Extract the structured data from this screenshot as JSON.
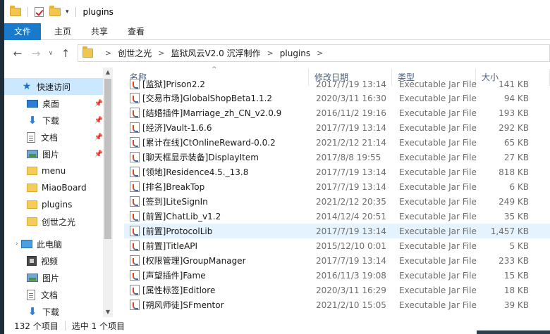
{
  "titlebar": {
    "title": "plugins",
    "dropdown_glyph": "▾"
  },
  "ribbon": {
    "tabs": [
      "文件",
      "主页",
      "共享",
      "查看"
    ]
  },
  "address": {
    "back": "←",
    "forward": "→",
    "recent": "∨",
    "up": "↑",
    "crumbs": [
      "创世之光",
      "监狱风云V2.0 沉浮制作",
      "plugins"
    ],
    "sep": ">"
  },
  "nav": {
    "quick_access": "快速访问",
    "items": [
      {
        "label": "桌面",
        "icon": "desktop-icon",
        "pinned": true
      },
      {
        "label": "下载",
        "icon": "download-icon",
        "pinned": true
      },
      {
        "label": "文档",
        "icon": "document-icon",
        "pinned": true
      },
      {
        "label": "图片",
        "icon": "pictures-icon",
        "pinned": true
      },
      {
        "label": "menu",
        "icon": "folder-icon"
      },
      {
        "label": "MiaoBoard",
        "icon": "folder-icon"
      },
      {
        "label": "plugins",
        "icon": "folder-icon"
      },
      {
        "label": "创世之光",
        "icon": "folder-icon"
      }
    ],
    "this_pc": "此电脑",
    "pc_items": [
      {
        "label": "视频",
        "icon": "video-icon"
      },
      {
        "label": "图片",
        "icon": "pictures-icon"
      },
      {
        "label": "文档",
        "icon": "document-icon"
      },
      {
        "label": "下载",
        "icon": "download-icon"
      }
    ],
    "pin_glyph": "📌"
  },
  "list": {
    "columns": {
      "name": "名称",
      "date": "修改日期",
      "type": "类型",
      "size": "大小"
    },
    "rows": [
      {
        "name": "[监狱]Prison2.2",
        "date": "2017/7/19 13:14",
        "type": "Executable Jar File",
        "size": "141 KB"
      },
      {
        "name": "[交易市场]GlobalShopBeta1.1.2",
        "date": "2020/3/11 16:30",
        "type": "Executable Jar File",
        "size": "94 KB"
      },
      {
        "name": "[结婚插件]Marriage_zh_CN_v2.0.9",
        "date": "2016/11/2 19:16",
        "type": "Executable Jar File",
        "size": "193 KB"
      },
      {
        "name": "[经济]Vault-1.6.6",
        "date": "2017/7/19 13:14",
        "type": "Executable Jar File",
        "size": "292 KB"
      },
      {
        "name": "[累计在线]CtOnlineReward-0.0.2",
        "date": "2021/2/12 21:14",
        "type": "Executable Jar File",
        "size": "65 KB"
      },
      {
        "name": "[聊天框显示装备]DisplayItem",
        "date": "2017/8/8 19:55",
        "type": "Executable Jar File",
        "size": "27 KB"
      },
      {
        "name": "[领地]Residence4.5._13.8",
        "date": "2017/7/19 13:14",
        "type": "Executable Jar File",
        "size": "818 KB"
      },
      {
        "name": "[排名]BreakTop",
        "date": "2017/7/19 13:14",
        "type": "Executable Jar File",
        "size": "6 KB"
      },
      {
        "name": "[签到]LiteSignIn",
        "date": "2021/2/12 20:35",
        "type": "Executable Jar File",
        "size": "249 KB"
      },
      {
        "name": "[前置]ChatLib_v1.2",
        "date": "2014/12/4 20:51",
        "type": "Executable Jar File",
        "size": "35 KB"
      },
      {
        "name": "[前置]ProtocolLib",
        "date": "2017/7/19 13:14",
        "type": "Executable Jar File",
        "size": "1,457 KB",
        "selected": true
      },
      {
        "name": "[前置]TitleAPI",
        "date": "2015/12/10 0:01",
        "type": "Executable Jar File",
        "size": "5 KB"
      },
      {
        "name": "[权限管理]GroupManager",
        "date": "2017/7/19 13:14",
        "type": "Executable Jar File",
        "size": "233 KB"
      },
      {
        "name": "[声望插件]Fame",
        "date": "2016/11/3 19:08",
        "type": "Executable Jar File",
        "size": "15 KB"
      },
      {
        "name": "[属性标签]Editlore",
        "date": "2020/3/11 16:29",
        "type": "Executable Jar File",
        "size": "18 KB"
      },
      {
        "name": "[朔风师徒]SFmentor",
        "date": "2021/2/10 15:05",
        "type": "Executable Jar File",
        "size": "39 KB"
      }
    ]
  },
  "status": {
    "count": "132 个项目",
    "selection": "选中 1 个项目"
  },
  "colors": {
    "accent": "#1979ca",
    "selection": "#cce8ff",
    "row_selection": "#e5f3ff",
    "folder": "#f2c54f"
  }
}
